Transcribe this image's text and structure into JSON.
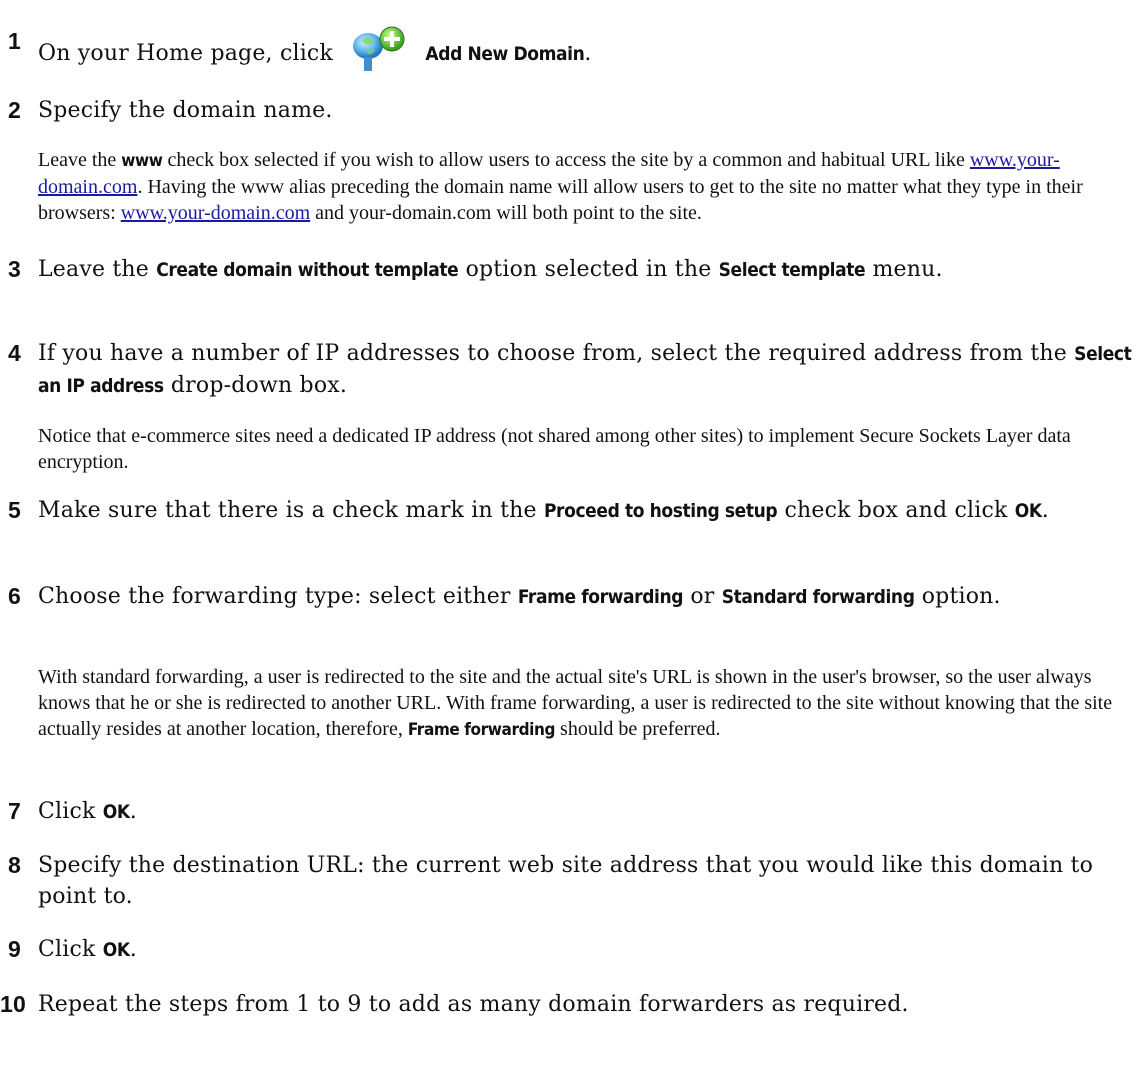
{
  "steps": {
    "s1": {
      "num": "1",
      "pre": "On your Home page, click",
      "label": "Add New Domain",
      "post": "."
    },
    "s2": {
      "num": "2",
      "text": "Specify the domain name."
    },
    "n2": {
      "a": "Leave the",
      "b": "www",
      "c": "check box selected if you wish to allow users to access the site by a common and habitual URL like",
      "link1": "www.your-domain.com",
      "d": ". Having the www alias preceding the domain name will allow users to get to the site no matter what they type in their browsers:",
      "link2": "www.your-domain.com",
      "e": "and your-domain.com will both point to the site."
    },
    "s3": {
      "num": "3",
      "a": "Leave the",
      "b": "Create domain without template",
      "c": "option selected in the",
      "d": "Select template",
      "e": "menu."
    },
    "s4": {
      "num": "4",
      "a": "If you have a number of IP addresses to choose from, select the required address from the",
      "b": "Select an IP address",
      "c": "drop-down box."
    },
    "n4": {
      "text": "Notice that e-commerce sites need a dedicated IP address (not shared among other sites) to implement Secure Sockets Layer data encryption."
    },
    "s5": {
      "num": "5",
      "a": "Make sure that there is a check mark in the",
      "b": "Proceed to hosting setup",
      "c": "check box and click",
      "d": "OK",
      "e": "."
    },
    "s6": {
      "num": "6",
      "a": "Choose the forwarding type: select either",
      "b": "Frame forwarding",
      "c": "or",
      "d": "Standard forwarding",
      "e": "option."
    },
    "n6": {
      "a": "With standard forwarding, a user is redirected to the site and the actual site's URL is shown in the user's browser, so the user always knows that he or she is redirected to another URL. With frame forwarding, a user is redirected to the site without knowing that the site actually resides at another location, therefore,",
      "b": "Frame forwarding",
      "c": "should be preferred."
    },
    "s7": {
      "num": "7",
      "a": "Click",
      "b": "OK",
      "c": "."
    },
    "s8": {
      "num": "8",
      "text": "Specify the destination URL: the current web site address that you would like this domain to point to."
    },
    "s9": {
      "num": "9",
      "a": "Click",
      "b": "OK",
      "c": "."
    },
    "s10": {
      "num": "10",
      "text": "Repeat the steps from 1 to 9 to add as many domain forwarders as required."
    }
  },
  "icons": {
    "add_domain": "add-new-domain-icon"
  }
}
